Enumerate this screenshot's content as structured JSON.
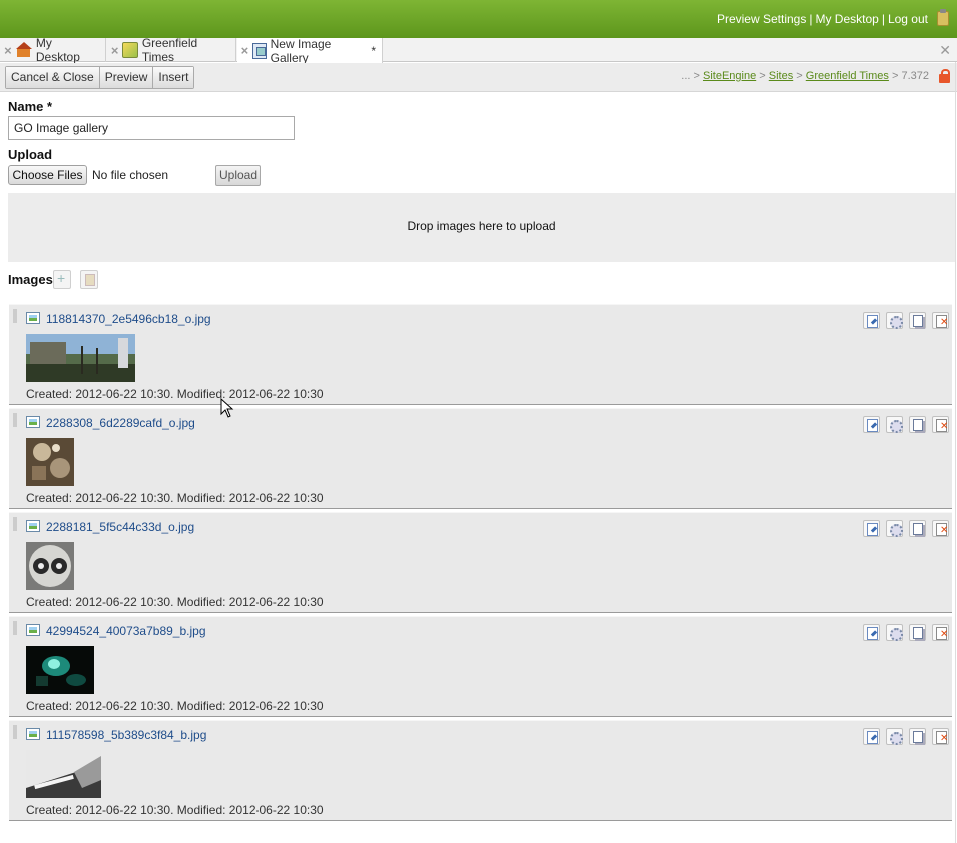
{
  "header": {
    "links": [
      "Preview Settings",
      "My Desktop",
      "Log out"
    ],
    "sep": "|"
  },
  "tabs": [
    {
      "label": "My Desktop",
      "icon": "home-icon"
    },
    {
      "label": "Greenfield Times",
      "icon": "site-icon"
    },
    {
      "label": "New Image Gallery",
      "icon": "gallery-icon",
      "modified": "*"
    }
  ],
  "toolbar": {
    "cancel_label": "Cancel & Close",
    "preview_label": "Preview",
    "insert_label": "Insert"
  },
  "breadcrumb": {
    "prefix": "... > ",
    "items": [
      "SiteEngine",
      "Sites",
      "Greenfield Times"
    ],
    "sep": " > ",
    "tail": " > 7.372"
  },
  "form": {
    "name_label": "Name *",
    "name_value": "GO Image gallery",
    "upload_label": "Upload",
    "choose_label": "Choose Files",
    "no_file": "No file chosen",
    "upload_button": "Upload",
    "drop_text": "Drop images here to upload",
    "images_label": "Images"
  },
  "images": [
    {
      "file": "118814370_2e5496cb18_o.jpg",
      "meta": "Created: 2012-06-22 10:30. Modified: 2012-06-22 10:30"
    },
    {
      "file": "2288308_6d2289cafd_o.jpg",
      "meta": "Created: 2012-06-22 10:30. Modified: 2012-06-22 10:30"
    },
    {
      "file": "2288181_5f5c44c33d_o.jpg",
      "meta": "Created: 2012-06-22 10:30. Modified: 2012-06-22 10:30"
    },
    {
      "file": "42994524_40073a7b89_b.jpg",
      "meta": "Created: 2012-06-22 10:30. Modified: 2012-06-22 10:30"
    },
    {
      "file": "111578598_5b389c3f84_b.jpg",
      "meta": "Created: 2012-06-22 10:30. Modified: 2012-06-22 10:30"
    }
  ],
  "colors": {
    "header_green": "#6aa526",
    "link_blue": "#1e4c8a",
    "crumb_green": "#5a8a1a"
  }
}
